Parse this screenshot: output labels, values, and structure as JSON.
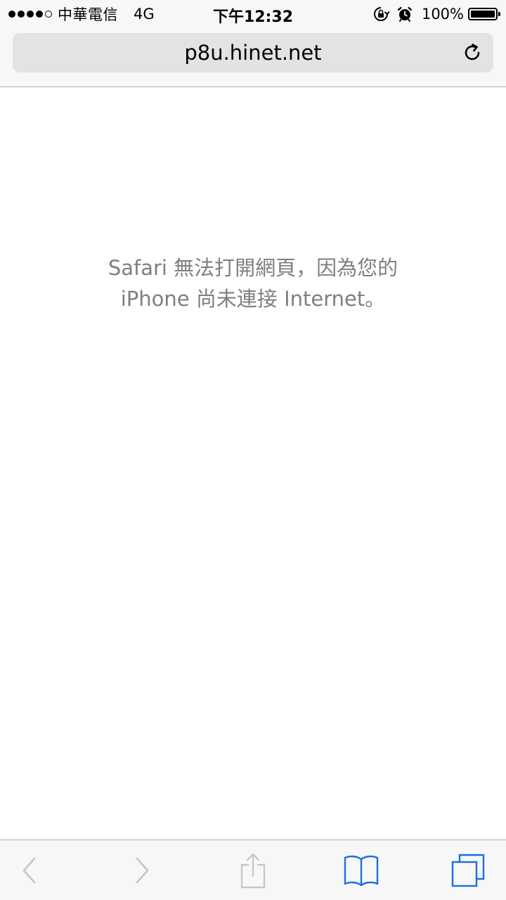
{
  "status_bar": {
    "signal_dots_filled": 4,
    "signal_dots_total": 5,
    "carrier": "中華電信",
    "network": "4G",
    "time": "下午12:32",
    "battery_percent_label": "100%",
    "battery_level": 1.0,
    "icons": [
      "orientation-lock-icon",
      "alarm-icon",
      "battery-icon"
    ]
  },
  "address_bar": {
    "url": "p8u.hinet.net",
    "reload_icon": "reload-icon"
  },
  "error": {
    "line1": "Safari 無法打開網頁，因為您的",
    "line2": "iPhone 尚未連接 Internet。"
  },
  "toolbar": {
    "buttons": [
      {
        "name": "back",
        "icon": "chevron-left-icon",
        "enabled": false
      },
      {
        "name": "forward",
        "icon": "chevron-right-icon",
        "enabled": false
      },
      {
        "name": "share",
        "icon": "share-icon",
        "enabled": false
      },
      {
        "name": "bookmarks",
        "icon": "book-icon",
        "enabled": true
      },
      {
        "name": "tabs",
        "icon": "tabs-icon",
        "enabled": true
      }
    ]
  },
  "colors": {
    "accent": "#1a6fe0",
    "disabled": "#c4c4c9",
    "message_text": "#7f7f7f",
    "chrome_bg": "#f7f7f7",
    "address_bg": "#e3e3e6"
  }
}
